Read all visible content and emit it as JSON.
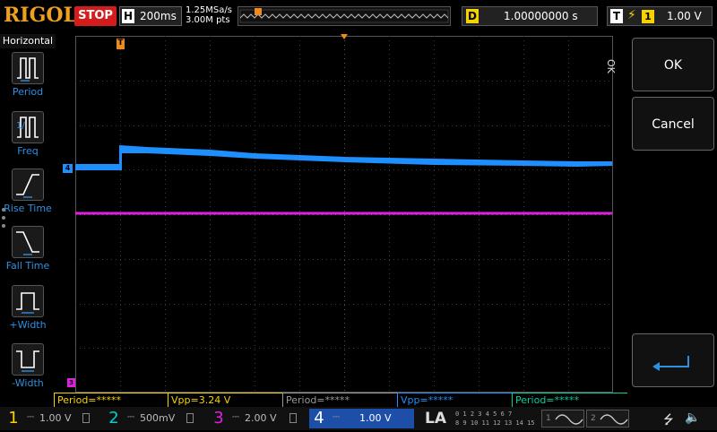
{
  "header": {
    "logo": "RIGOL",
    "run_status": "STOP",
    "timebase": {
      "key": "H",
      "value": "200ms"
    },
    "sample_rate": "1.25MSa/s",
    "memory_depth": "3.00M pts",
    "delay": {
      "key": "D",
      "value": "1.00000000 s"
    },
    "trigger": {
      "key": "T",
      "source": "1",
      "level": "1.00 V"
    }
  },
  "left_menu": {
    "title": "Horizontal",
    "items": [
      {
        "label": "Period"
      },
      {
        "label": "Freq"
      },
      {
        "label": "Rise Time"
      },
      {
        "label": "Fall Time"
      },
      {
        "label": "+Width"
      },
      {
        "label": "-Width"
      }
    ]
  },
  "right_panel": {
    "side_label": "OK",
    "ok": "OK",
    "cancel": "Cancel"
  },
  "markers": {
    "trigger_position": "T",
    "ch4_ref": "4",
    "trigger_level": "T",
    "ch3_ref": "3"
  },
  "measurements": [
    {
      "text": "Period=*****",
      "color": "#f5d300"
    },
    {
      "text": "Vpp=3.24 V",
      "color": "#f5d300"
    },
    {
      "text": "Period=*****",
      "color": "#9a9a9a"
    },
    {
      "text": "Vpp=*****",
      "color": "#1e8fff"
    },
    {
      "text": "Period=*****",
      "color": "#00d0a0"
    }
  ],
  "channels": [
    {
      "num": "1",
      "scale": "1.00 V",
      "color": "#f5d300",
      "active": false
    },
    {
      "num": "2",
      "scale": "500mV",
      "color": "#00d0d0",
      "active": false
    },
    {
      "num": "3",
      "scale": "2.00 V",
      "color": "#e020e0",
      "active": false
    },
    {
      "num": "4",
      "scale": "1.00 V",
      "color": "#1e8fff",
      "active": true
    }
  ],
  "la": {
    "label": "LA",
    "bits_row1": "0 1 2 3  4 5 6 7",
    "bits_row2": "8 9 10 11 12 13 14 15"
  },
  "generators": [
    {
      "num": "1"
    },
    {
      "num": "2"
    }
  ],
  "waveforms": {
    "ch4": {
      "color": "#1e8fff"
    },
    "ch3": {
      "color": "#e020e0"
    }
  },
  "colors": {
    "grid": "#3a3a3a",
    "menu_accent": "#2f8fe0",
    "trigger_marker": "#f08a1a"
  }
}
